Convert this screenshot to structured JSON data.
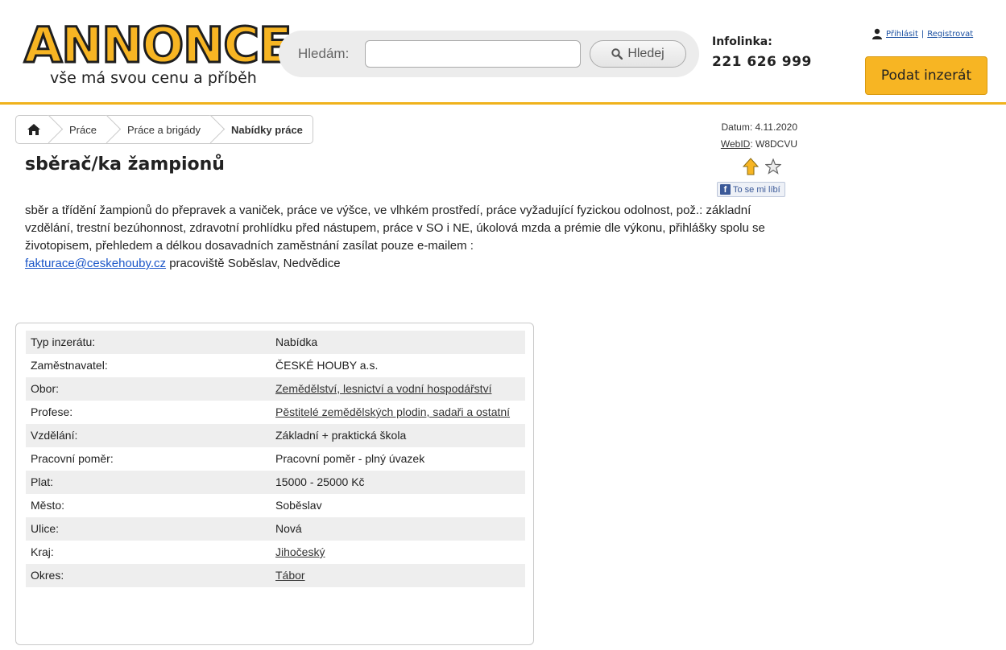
{
  "header": {
    "logo_word": "ANNONCE",
    "logo_tagline": "vše má svou cenu a příběh",
    "search_label": "Hledám:",
    "search_value": "",
    "search_placeholder": "",
    "search_button": "Hledej",
    "infoline_label": "Infolinka:",
    "infoline_phone": "221 626 999",
    "login": "Přihlásit",
    "separator": "|",
    "register": "Registrovat",
    "submit_ad": "Podat inzerát",
    "accent_color": "#f7b523"
  },
  "breadcrumb": {
    "home_icon": "home-icon",
    "items": [
      "Práce",
      "Práce a brigády",
      "Nabídky práce"
    ]
  },
  "meta": {
    "date": "Datum: 4.11.2020",
    "webid_label": "WebID",
    "webid_value": ": W8DCVU",
    "like": "To se mi líbí",
    "icons": [
      "up-arrow-icon",
      "star-icon"
    ]
  },
  "ad": {
    "title": "sběrač/ka žampionů",
    "description": "sběr a třídění žampionů do přepravek a vaniček, práce ve výšce, ve vlhkém prostředí, práce vyžadující fyzickou odolnost, pož.: základní vzdělání, trestní bezúhonnost, zdravotní prohlídku před nástupem, práce v SO i NE, úkolová mzda a prémie dle výkonu, přihlášky spolu se životopisem, přehledem a délkou dosavadních zaměstnání zasílat pouze e-mailem :",
    "email": "fakturace@ceskehouby.cz",
    "description_tail": " pracoviště Soběslav, Nedvědice"
  },
  "details": [
    {
      "label": "Typ inzerátu:",
      "value": "Nabídka",
      "link": false
    },
    {
      "label": "Zaměstnavatel:",
      "value": "ČESKÉ HOUBY a.s.",
      "link": false
    },
    {
      "label": "Obor:",
      "value": "Zemědělství, lesnictví a vodní hospodářství",
      "link": true
    },
    {
      "label": "Profese:",
      "value": "Pěstitelé zemědělských plodin, sadaři a ostatní",
      "link": true
    },
    {
      "label": "Vzdělání:",
      "value": "Základní + praktická škola",
      "link": false
    },
    {
      "label": "Pracovní poměr:",
      "value": "Pracovní poměr - plný úvazek",
      "link": false
    },
    {
      "label": "Plat:",
      "value": "15000 - 25000 Kč",
      "link": false
    },
    {
      "label": "Město:",
      "value": "Soběslav",
      "link": false
    },
    {
      "label": "Ulice:",
      "value": "Nová",
      "link": false
    },
    {
      "label": "Kraj:",
      "value": "Jihočeský",
      "link": true
    },
    {
      "label": "Okres:",
      "value": "Tábor",
      "link": true
    }
  ]
}
